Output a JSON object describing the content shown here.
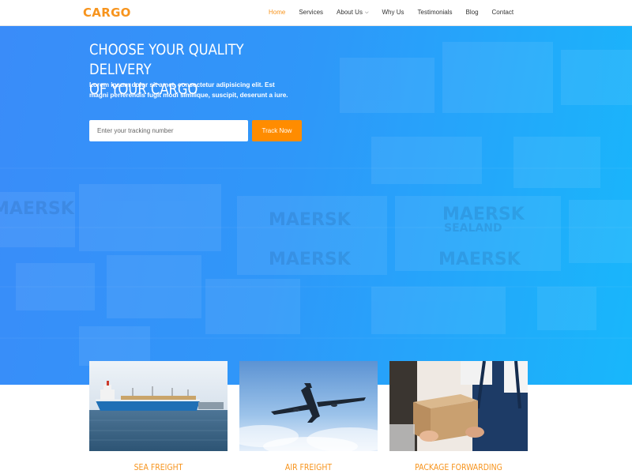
{
  "brand": {
    "logo": "CARGO"
  },
  "nav": {
    "items": [
      {
        "label": "Home",
        "active": true
      },
      {
        "label": "Services"
      },
      {
        "label": "About Us",
        "dropdown": true
      },
      {
        "label": "Why Us"
      },
      {
        "label": "Testimonials"
      },
      {
        "label": "Blog"
      },
      {
        "label": "Contact"
      }
    ]
  },
  "hero": {
    "title_line1": "CHOOSE YOUR QUALITY DELIVERY",
    "title_line2": "OF YOUR CARGO",
    "text": "Lorem ipsum dolor sit amet, consectetur adipisicing elit. Est magni perferendis fugit modi similique, suscipit, deserunt a iure.",
    "background_words": [
      "MAERSK",
      "MAERSK",
      "MAERSK",
      "MAERSK",
      "MAERSK",
      "SEALAND"
    ]
  },
  "tracking": {
    "placeholder": "Enter your tracking number",
    "button_label": "Track Now"
  },
  "services": [
    {
      "title": "SEA FREIGHT",
      "image": "ship"
    },
    {
      "title": "AIR FREIGHT",
      "image": "airplane"
    },
    {
      "title": "PACKAGE FORWARDING",
      "image": "package-handoff"
    }
  ],
  "colors": {
    "accent": "#f7941d",
    "button": "#ff8c00",
    "hero_blue": "#2f97f9",
    "hero_cyan": "#18b7fb"
  }
}
